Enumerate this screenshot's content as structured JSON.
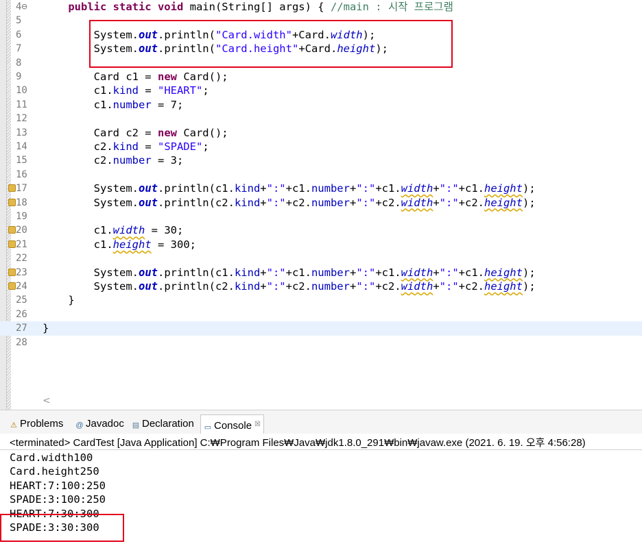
{
  "editor": {
    "lines": [
      {
        "num": "4⊖",
        "segments": [
          [
            "    ",
            ""
          ],
          [
            "public static void ",
            "kw"
          ],
          [
            "main(String[] args) { ",
            ""
          ],
          [
            "//main : 시작 프로그램",
            "cmt"
          ]
        ]
      },
      {
        "num": "5",
        "segments": []
      },
      {
        "num": "6",
        "segments": [
          [
            "        System.",
            ""
          ],
          [
            "out",
            "out"
          ],
          [
            ".println(",
            ""
          ],
          [
            "\"Card.width\"",
            "str"
          ],
          [
            "+Card.",
            ""
          ],
          [
            "width",
            "sfld"
          ],
          [
            ");",
            ""
          ]
        ]
      },
      {
        "num": "7",
        "segments": [
          [
            "        System.",
            ""
          ],
          [
            "out",
            "out"
          ],
          [
            ".println(",
            ""
          ],
          [
            "\"Card.height\"",
            "str"
          ],
          [
            "+Card.",
            ""
          ],
          [
            "height",
            "sfld"
          ],
          [
            ");",
            ""
          ]
        ]
      },
      {
        "num": "8",
        "segments": []
      },
      {
        "num": "9",
        "segments": [
          [
            "        Card c1 = ",
            ""
          ],
          [
            "new ",
            "kw"
          ],
          [
            "Card();",
            ""
          ]
        ]
      },
      {
        "num": "10",
        "segments": [
          [
            "        c1.",
            ""
          ],
          [
            "kind",
            "fld"
          ],
          [
            " = ",
            ""
          ],
          [
            "\"HEART\"",
            "str"
          ],
          [
            ";",
            ""
          ]
        ]
      },
      {
        "num": "11",
        "segments": [
          [
            "        c1.",
            ""
          ],
          [
            "number",
            "fld"
          ],
          [
            " = 7;",
            ""
          ]
        ]
      },
      {
        "num": "12",
        "segments": []
      },
      {
        "num": "13",
        "segments": [
          [
            "        Card c2 = ",
            ""
          ],
          [
            "new ",
            "kw"
          ],
          [
            "Card();",
            ""
          ]
        ]
      },
      {
        "num": "14",
        "segments": [
          [
            "        c2.",
            ""
          ],
          [
            "kind",
            "fld"
          ],
          [
            " = ",
            ""
          ],
          [
            "\"SPADE\"",
            "str"
          ],
          [
            ";",
            ""
          ]
        ]
      },
      {
        "num": "15",
        "segments": [
          [
            "        c2.",
            ""
          ],
          [
            "number",
            "fld"
          ],
          [
            " = 3;",
            ""
          ]
        ]
      },
      {
        "num": "16",
        "segments": []
      },
      {
        "num": "17",
        "marker": true,
        "segments": [
          [
            "        System.",
            ""
          ],
          [
            "out",
            "out"
          ],
          [
            ".println(c1.",
            ""
          ],
          [
            "kind",
            "fld"
          ],
          [
            "+",
            ""
          ],
          [
            "\":\"",
            "str"
          ],
          [
            "+c1.",
            ""
          ],
          [
            "number",
            "fld"
          ],
          [
            "+",
            ""
          ],
          [
            "\":\"",
            "str"
          ],
          [
            "+c1.",
            ""
          ],
          [
            "width",
            "sfld warn"
          ],
          [
            "+",
            ""
          ],
          [
            "\":\"",
            "str"
          ],
          [
            "+c1.",
            ""
          ],
          [
            "height",
            "sfld warn"
          ],
          [
            ");",
            ""
          ]
        ]
      },
      {
        "num": "18",
        "marker": true,
        "segments": [
          [
            "        System.",
            ""
          ],
          [
            "out",
            "out"
          ],
          [
            ".println(c2.",
            ""
          ],
          [
            "kind",
            "fld"
          ],
          [
            "+",
            ""
          ],
          [
            "\":\"",
            "str"
          ],
          [
            "+c2.",
            ""
          ],
          [
            "number",
            "fld"
          ],
          [
            "+",
            ""
          ],
          [
            "\":\"",
            "str"
          ],
          [
            "+c2.",
            ""
          ],
          [
            "width",
            "sfld warn"
          ],
          [
            "+",
            ""
          ],
          [
            "\":\"",
            "str"
          ],
          [
            "+c2.",
            ""
          ],
          [
            "height",
            "sfld warn"
          ],
          [
            ");",
            ""
          ]
        ]
      },
      {
        "num": "19",
        "segments": []
      },
      {
        "num": "20",
        "marker": true,
        "segments": [
          [
            "        c1.",
            ""
          ],
          [
            "width",
            "sfld warn"
          ],
          [
            " = 30;",
            ""
          ]
        ]
      },
      {
        "num": "21",
        "marker": true,
        "segments": [
          [
            "        c1.",
            ""
          ],
          [
            "height",
            "sfld warn"
          ],
          [
            " = 300;",
            ""
          ]
        ]
      },
      {
        "num": "22",
        "segments": []
      },
      {
        "num": "23",
        "marker": true,
        "segments": [
          [
            "        System.",
            ""
          ],
          [
            "out",
            "out"
          ],
          [
            ".println(c1.",
            ""
          ],
          [
            "kind",
            "fld"
          ],
          [
            "+",
            ""
          ],
          [
            "\":\"",
            "str"
          ],
          [
            "+c1.",
            ""
          ],
          [
            "number",
            "fld"
          ],
          [
            "+",
            ""
          ],
          [
            "\":\"",
            "str"
          ],
          [
            "+c1.",
            ""
          ],
          [
            "width",
            "sfld warn"
          ],
          [
            "+",
            ""
          ],
          [
            "\":\"",
            "str"
          ],
          [
            "+c1.",
            ""
          ],
          [
            "height",
            "sfld warn"
          ],
          [
            ");",
            ""
          ]
        ]
      },
      {
        "num": "24",
        "marker": true,
        "segments": [
          [
            "        System.",
            ""
          ],
          [
            "out",
            "out"
          ],
          [
            ".println(c2.",
            ""
          ],
          [
            "kind",
            "fld"
          ],
          [
            "+",
            ""
          ],
          [
            "\":\"",
            "str"
          ],
          [
            "+c2.",
            ""
          ],
          [
            "number",
            "fld"
          ],
          [
            "+",
            ""
          ],
          [
            "\":\"",
            "str"
          ],
          [
            "+c2.",
            ""
          ],
          [
            "width",
            "sfld warn"
          ],
          [
            "+",
            ""
          ],
          [
            "\":\"",
            "str"
          ],
          [
            "+c2.",
            ""
          ],
          [
            "height",
            "sfld warn"
          ],
          [
            ");",
            ""
          ]
        ]
      },
      {
        "num": "25",
        "segments": [
          [
            "    }",
            ""
          ]
        ]
      },
      {
        "num": "26",
        "segments": []
      },
      {
        "num": "27",
        "current": true,
        "segments": [
          [
            "}",
            ""
          ]
        ]
      },
      {
        "num": "28",
        "segments": []
      }
    ],
    "scroll_left_glyph": "<"
  },
  "panel": {
    "tabs": [
      {
        "icon": "⚠",
        "label": "Problems",
        "active": false
      },
      {
        "icon": "@",
        "label": "Javadoc",
        "active": false
      },
      {
        "icon": "▤",
        "label": "Declaration",
        "active": false
      },
      {
        "icon": "▭",
        "label": "Console",
        "active": true,
        "close": "☒"
      }
    ],
    "status": "<terminated> CardTest [Java Application] C:₩Program Files₩Java₩jdk1.8.0_291₩bin₩javaw.exe  (2021. 6. 19. 오후 4:56:28)",
    "output": [
      "Card.width100",
      "Card.height250",
      "HEART:7:100:250",
      "SPADE:3:100:250",
      "HEART:7:30:300",
      "SPADE:3:30:300"
    ]
  }
}
